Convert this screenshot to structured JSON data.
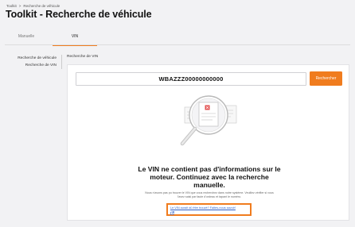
{
  "breadcrumb": {
    "root": "Toolkit",
    "separator": ">",
    "current": "Recherche de véhicule"
  },
  "page": {
    "title": "Toolkit - Recherche de véhicule"
  },
  "tabs": [
    {
      "label": "Manuelle",
      "active": false
    },
    {
      "label": "VIN",
      "active": true
    }
  ],
  "side_menu": {
    "items": [
      {
        "label": "Recherche de véhicule"
      },
      {
        "label": "Recherche de VIN"
      }
    ]
  },
  "main": {
    "section_label": "Recherche de VIN",
    "vin_input_value": "WBAZZZ00000000000",
    "search_button_label": "Rechercher",
    "message_title": "Le VIN ne contient pas d'informations sur le moteur. Continuez avec la recherche manuelle.",
    "message_description": "Nous n'avons pas pu trouver le VIN que vous recherchez dans notre système. Veuillez vérifier si vous l'avez saisi par faute d'ordeau et tapant le numéro.",
    "feedback_link_label": "Le VIN aurait dû être trouvé? Faites-nous savoir!"
  },
  "colors": {
    "accent": "#f07c1e",
    "link": "#2b5fc9",
    "background": "#f2f2f4",
    "card": "#ffffff"
  },
  "icons": {
    "illustration": "magnifier-over-documents-illustration",
    "feedback_link": "external-link-icon"
  }
}
